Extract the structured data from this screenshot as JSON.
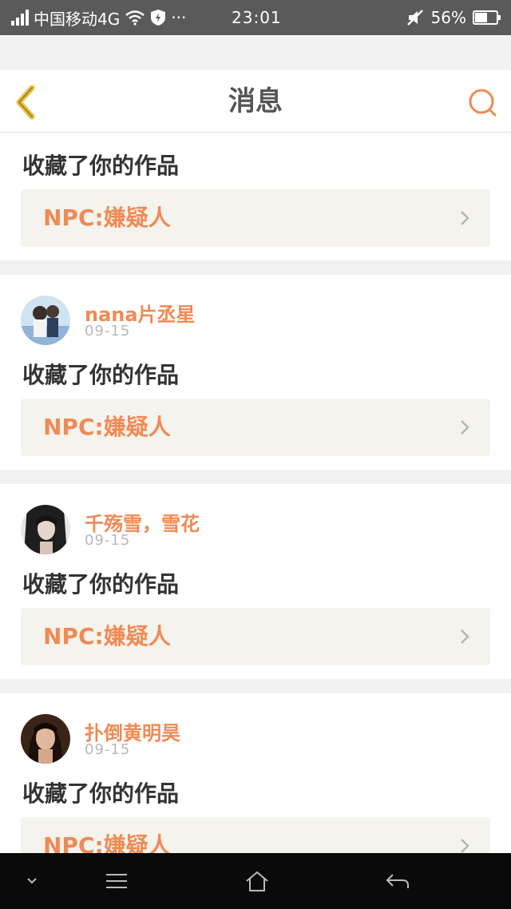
{
  "status_bar": {
    "carrier": "中国移动4G",
    "time": "23:01",
    "battery": "56%",
    "more_dots": "···"
  },
  "header": {
    "title": "消息"
  },
  "messages": [
    {
      "username": "",
      "date": "",
      "action": "收藏了你的作品",
      "work_title": "NPC:嫌疑人"
    },
    {
      "username": "nana片丞星",
      "date": "09-15",
      "action": "收藏了你的作品",
      "work_title": "NPC:嫌疑人"
    },
    {
      "username": "千殇雪，雪花",
      "date": "09-15",
      "action": "收藏了你的作品",
      "work_title": "NPC:嫌疑人"
    },
    {
      "username": "扑倒黄明昊",
      "date": "09-15",
      "action": "收藏了你的作品",
      "work_title": "NPC:嫌疑人"
    }
  ],
  "colors": {
    "accent": "#f08a54",
    "back_icon": "#e8c040",
    "status_bar_bg": "#5a5a5a",
    "work_card_bg": "#f4f3ee"
  }
}
